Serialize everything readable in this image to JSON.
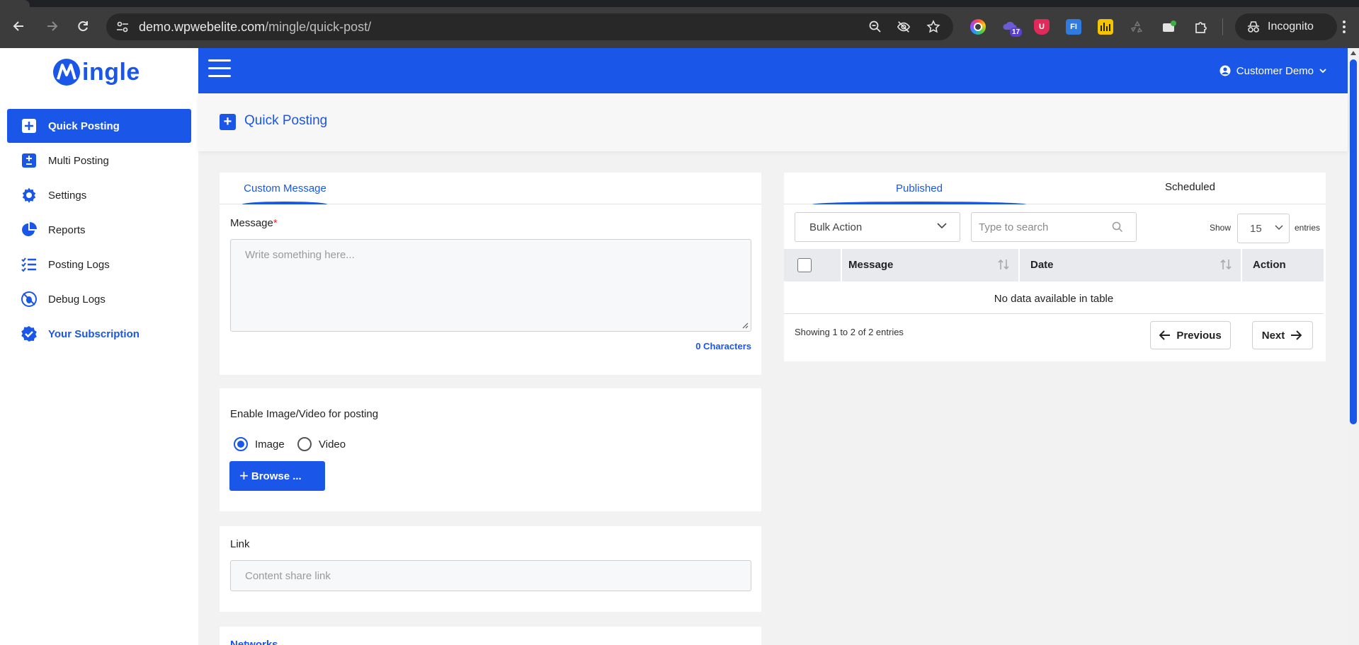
{
  "browser": {
    "url_host": "demo.wpwebelite.com",
    "url_path": "/mingle/quick-post/",
    "incognito_label": "Incognito",
    "extension_badge": "17",
    "ext_u": "U",
    "ext_fi": "FI"
  },
  "brand": {
    "logo_text": "ingle",
    "logo_letter": "M",
    "accent": "#1a56e8"
  },
  "sidebar": {
    "items": [
      {
        "label": "Quick Posting",
        "icon": "plus-square-icon"
      },
      {
        "label": "Multi Posting",
        "icon": "plus-minus-icon"
      },
      {
        "label": "Settings",
        "icon": "gear-icon"
      },
      {
        "label": "Reports",
        "icon": "pie-chart-icon"
      },
      {
        "label": "Posting Logs",
        "icon": "list-check-icon"
      },
      {
        "label": "Debug Logs",
        "icon": "bug-icon"
      },
      {
        "label": "Your Subscription",
        "icon": "badge-check-icon"
      }
    ]
  },
  "topbar": {
    "user_name": "Customer Demo"
  },
  "page": {
    "title": "Quick Posting"
  },
  "composer": {
    "tab_label": "Custom Message",
    "message_label": "Message",
    "required_mark": "*",
    "message_placeholder": "Write something here...",
    "char_count": "0 Characters",
    "media_label": "Enable Image/Video for posting",
    "radio_image": "Image",
    "radio_video": "Video",
    "browse_label": "Browse ...",
    "link_label": "Link",
    "link_placeholder": "Content share link",
    "networks_label": "Networks"
  },
  "posts": {
    "tabs": [
      "Published",
      "Scheduled"
    ],
    "bulk_action": "Bulk Action",
    "search_placeholder": "Type to search",
    "show_label": "Show",
    "entries_value": "15",
    "entries_label": "entries",
    "columns": [
      "Message",
      "Date",
      "Action"
    ],
    "empty_text": "No data available in table",
    "info_text": "Showing 1 to 2 of 2 entries",
    "prev_label": "Previous",
    "next_label": "Next"
  }
}
